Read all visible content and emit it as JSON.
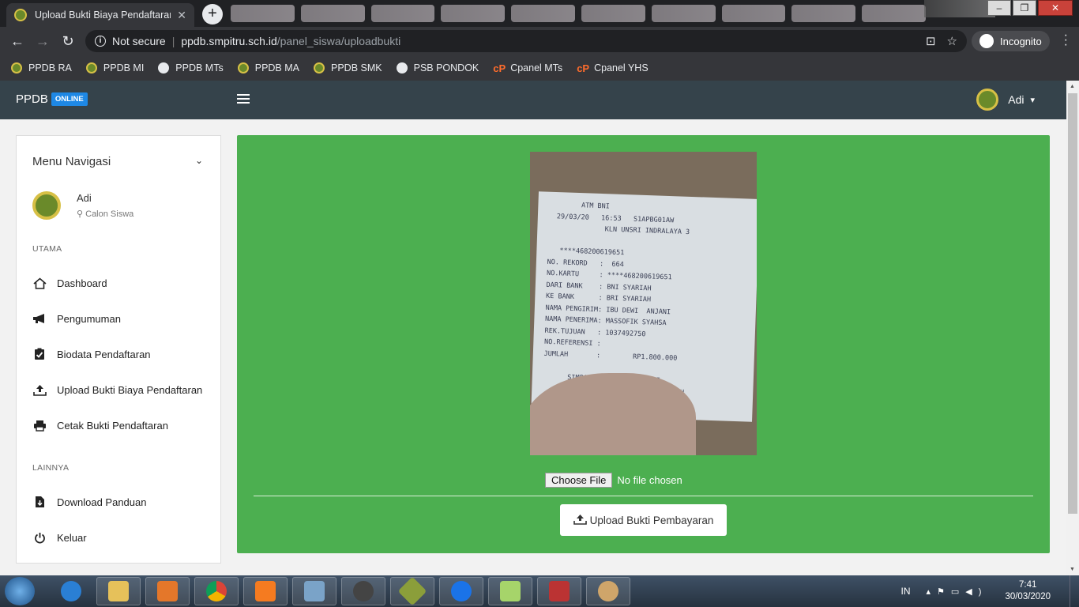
{
  "browser": {
    "active_tab_title": "Upload Bukti Biaya Pendaftaran",
    "security_label": "Not secure",
    "url_host": "ppdb.smpitru.sch.id",
    "url_path": "/panel_siswa/uploadbukti",
    "incognito_label": "Incognito",
    "bookmarks": [
      {
        "label": "PPDB RA",
        "icon": "school-logo-icon"
      },
      {
        "label": "PPDB MI",
        "icon": "school-logo-icon"
      },
      {
        "label": "PPDB MTs",
        "icon": "globe-icon"
      },
      {
        "label": "PPDB MA",
        "icon": "school-logo-icon"
      },
      {
        "label": "PPDB SMK",
        "icon": "school-logo-icon"
      },
      {
        "label": "PSB PONDOK",
        "icon": "globe-icon"
      },
      {
        "label": "Cpanel MTs",
        "icon": "cpanel-icon"
      },
      {
        "label": "Cpanel YHS",
        "icon": "cpanel-icon"
      }
    ]
  },
  "navbar": {
    "brand": "PPDB",
    "brand_badge": "ONLINE",
    "user_name": "Adi"
  },
  "sidebar": {
    "heading": "Menu Navigasi",
    "user_name": "Adi",
    "user_role": "Calon Siswa",
    "section_main": "UTAMA",
    "section_other": "LAINNYA",
    "items": [
      {
        "label": "Dashboard",
        "icon": "home-icon"
      },
      {
        "label": "Pengumuman",
        "icon": "megaphone-icon"
      },
      {
        "label": "Biodata Pendaftaran",
        "icon": "clipboard-check-icon"
      },
      {
        "label": "Upload Bukti Biaya Pendaftaran",
        "icon": "upload-icon"
      },
      {
        "label": "Cetak Bukti Pendaftaran",
        "icon": "printer-icon"
      }
    ],
    "other_items": [
      {
        "label": "Download Panduan",
        "icon": "download-file-icon"
      },
      {
        "label": "Keluar",
        "icon": "power-icon"
      }
    ]
  },
  "main": {
    "receipt_text": "        ATM BNI\n  29/03/20   16:53   S1APBG01AW\n              KLN UNSRI INDRALAYA 3\n\n   ****468200619651\nNO. REKORD   :  664\nNO.KARTU     : ****468200619651\nDARI BANK    : BNI SYARIAH\nKE BANK      : BRI SYARIAH\nNAMA PENGIRIM: IBU DEWI  ANJANI\nNAMA PENERIMA: MASSOFIK SYAHSA\nREK.TUJUAN   : 1037492750\nNO.REFERENSI :\nJUMLAH       :        RP1.800.000\n\n      SIMPAN TANDA TERIMA INI\n   SEBAGAI BUKTI TRANSAKSI YANG SAH",
    "file_button": "Choose File",
    "file_status": "No file chosen",
    "upload_button": "Upload Bukti Pembayaran"
  },
  "taskbar": {
    "language": "IN",
    "time": "7:41",
    "date": "30/03/2020"
  },
  "colors": {
    "card_green": "#4caf50",
    "navbar": "#35434b",
    "badge_blue": "#1e88e5"
  }
}
